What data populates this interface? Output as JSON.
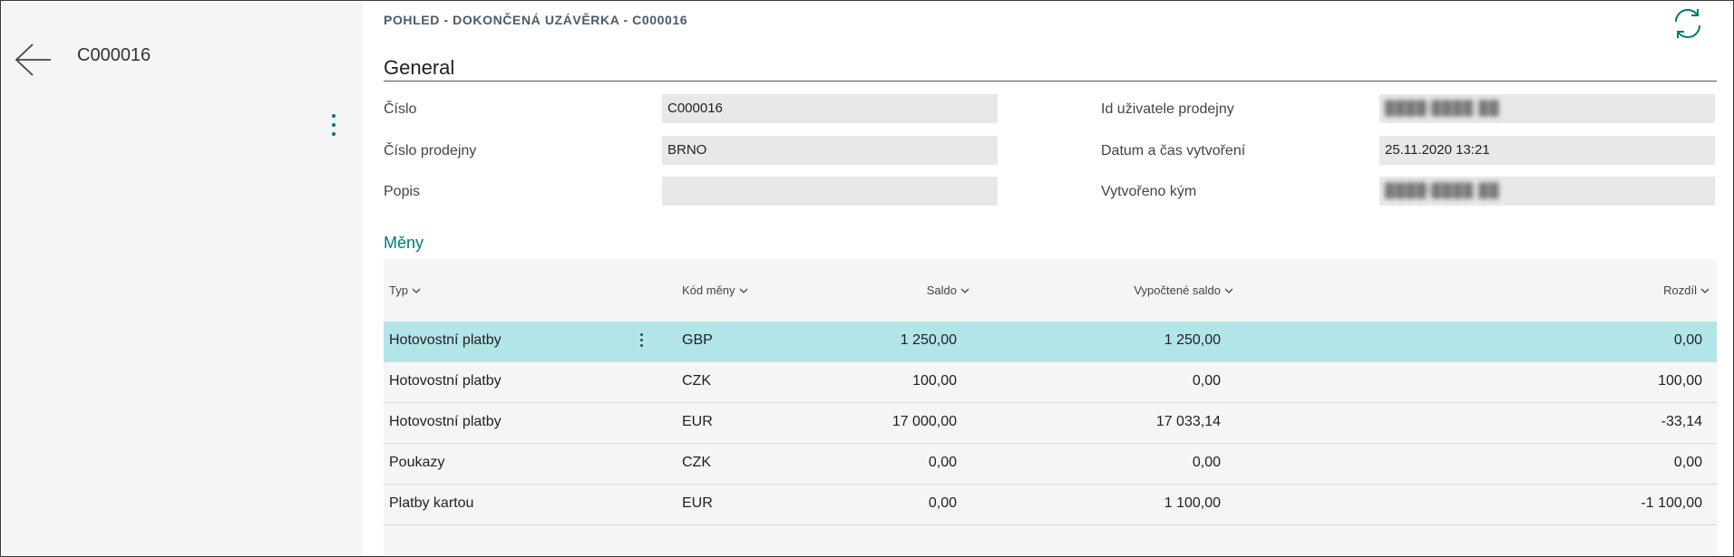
{
  "left_pane": {
    "title": "C000016"
  },
  "header": {
    "caption": "POHLED - DOKONČENÁ UZÁVĚRKA - C000016"
  },
  "general": {
    "title": "General",
    "fields": {
      "cislo": {
        "label": "Číslo",
        "value": "C000016"
      },
      "cislo_prodejny": {
        "label": "Číslo prodejny",
        "value": "BRNO"
      },
      "popis": {
        "label": "Popis",
        "value": ""
      },
      "id_uzivatele": {
        "label": "Id uživatele prodejny",
        "value": "████\\████ ██"
      },
      "datum": {
        "label": "Datum a čas vytvoření",
        "value": "25.11.2020 13:21"
      },
      "vytvoreno": {
        "label": "Vytvořeno kým",
        "value": "████\\████ ██"
      }
    }
  },
  "meny": {
    "title": "Měny",
    "columns": {
      "typ": "Typ",
      "kod": "Kód měny",
      "saldo": "Saldo",
      "vypoctene": "Vypočtené saldo",
      "rozdil": "Rozdíl"
    },
    "rows": [
      {
        "typ": "Hotovostní platby",
        "kod": "GBP",
        "saldo": "1 250,00",
        "vypoctene": "1 250,00",
        "rozdil": "0,00"
      },
      {
        "typ": "Hotovostní platby",
        "kod": "CZK",
        "saldo": "100,00",
        "vypoctene": "0,00",
        "rozdil": "100,00"
      },
      {
        "typ": "Hotovostní platby",
        "kod": "EUR",
        "saldo": "17 000,00",
        "vypoctene": "17 033,14",
        "rozdil": "-33,14"
      },
      {
        "typ": "Poukazy",
        "kod": "CZK",
        "saldo": "0,00",
        "vypoctene": "0,00",
        "rozdil": "0,00"
      },
      {
        "typ": "Platby kartou",
        "kod": "EUR",
        "saldo": "0,00",
        "vypoctene": "1 100,00",
        "rozdil": "-1 100,00"
      }
    ]
  },
  "colors": {
    "accent": "#00787a",
    "selected_row": "#b2e5e8",
    "field_bg": "#e8e8e8",
    "pane_bg": "#f5f5f5"
  },
  "icons": {
    "back": "arrow-left-icon",
    "more": "vertical-ellipsis-icon",
    "refresh": "refresh-icon",
    "sort": "chevron-down-icon"
  }
}
